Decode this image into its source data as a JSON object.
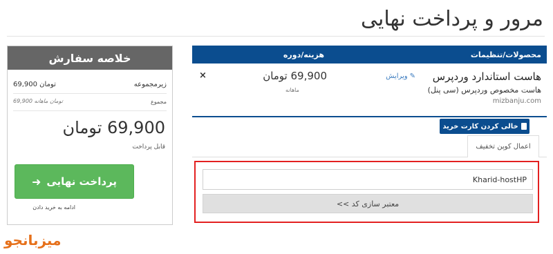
{
  "page": {
    "title": "مرور و پرداخت نهایی"
  },
  "cart": {
    "headers": {
      "products": "محصولات/تنظیمات",
      "price": "هزینه/دوره"
    },
    "item": {
      "name": "هاست استاندارد وردپرس",
      "edit_label": "ویرایش",
      "description": "هاست مخصوص وردپرس (سی پنل)",
      "domain": "mizbanju.com",
      "price": "69,900 تومان",
      "cycle": "ماهانه",
      "remove_symbol": "×"
    },
    "empty_cart_label": "خالی کردن کارت خرید",
    "promo_tab_label": "اعمال کوپن تخفیف",
    "promo_input_value": "Kharid-hostHP",
    "validate_button_label": "معتبر سازی کد >>"
  },
  "summary": {
    "title": "خلاصه سفارش",
    "subtotal_label": "زیرمجموعه",
    "subtotal_value": "69,900 تومان",
    "recurring_value": "69,900 تومان ماهانه",
    "recurring_label": "مجموع",
    "total_value": "69,900 تومان",
    "total_label": "قابل پرداخت",
    "checkout_label": "پرداخت نهایی",
    "continue_label": "ادامه به خرید دادن"
  },
  "watermark": "میزبانجو",
  "colors": {
    "primary": "#0b4d8f",
    "success": "#5cb85c",
    "summary_head": "#666666",
    "highlight": "#e32020"
  }
}
